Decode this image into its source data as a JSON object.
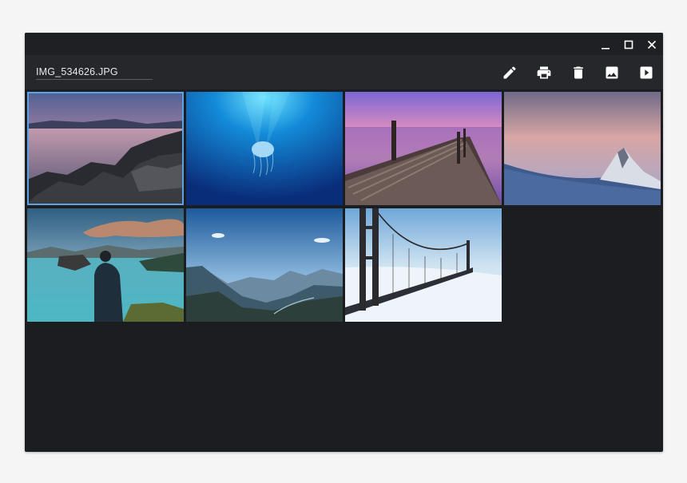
{
  "window": {
    "controls": [
      {
        "name": "minimize-icon"
      },
      {
        "name": "maximize-icon"
      },
      {
        "name": "close-icon"
      }
    ]
  },
  "toolbar": {
    "filename": "IMG_534626.JPG",
    "actions": [
      {
        "name": "edit-icon",
        "icon": "pencil"
      },
      {
        "name": "print-icon",
        "icon": "printer"
      },
      {
        "name": "delete-icon",
        "icon": "trash"
      },
      {
        "name": "image-icon",
        "icon": "landscape-image"
      },
      {
        "name": "slideshow-icon",
        "icon": "play"
      }
    ]
  },
  "gallery": {
    "selected_index": 0,
    "thumbnails": [
      {
        "name": "thumbnail-lake-rocks-sunset"
      },
      {
        "name": "thumbnail-jellyfish-underwater"
      },
      {
        "name": "thumbnail-wooden-pier-purple-sky"
      },
      {
        "name": "thumbnail-snowy-mountain-peak"
      },
      {
        "name": "thumbnail-man-by-lake"
      },
      {
        "name": "thumbnail-mountain-valley"
      },
      {
        "name": "thumbnail-golden-gate-bridge-fog"
      }
    ]
  },
  "colors": {
    "window_bg": "#1c1d20",
    "toolbar_bg": "#26272b",
    "selection_border": "#5da1e6",
    "icon": "#ffffff"
  }
}
